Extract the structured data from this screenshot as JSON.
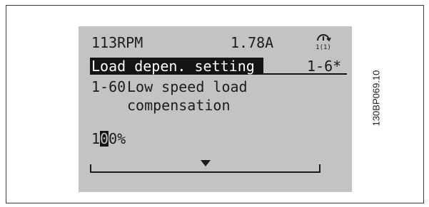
{
  "figure_id": "130BP069.10",
  "display": {
    "status": {
      "speed": "113RPM",
      "current": "1.78A",
      "setup_icon": "setup-1-icon",
      "setup_number": "1(1)"
    },
    "group": {
      "name": "Load depen. setting",
      "code": "1-6*"
    },
    "parameter": {
      "number": "1-60",
      "name_line1": "Low speed load",
      "name_line2": "compensation"
    },
    "value": {
      "digits": [
        "1",
        "0",
        "0"
      ],
      "cursor_digit_index": 1,
      "unit": "%",
      "slider_fraction": 0.5
    }
  },
  "colors": {
    "lcd_background": "#c3c3c3",
    "lcd_text": "#1c1c1c",
    "highlight": "#141414"
  }
}
